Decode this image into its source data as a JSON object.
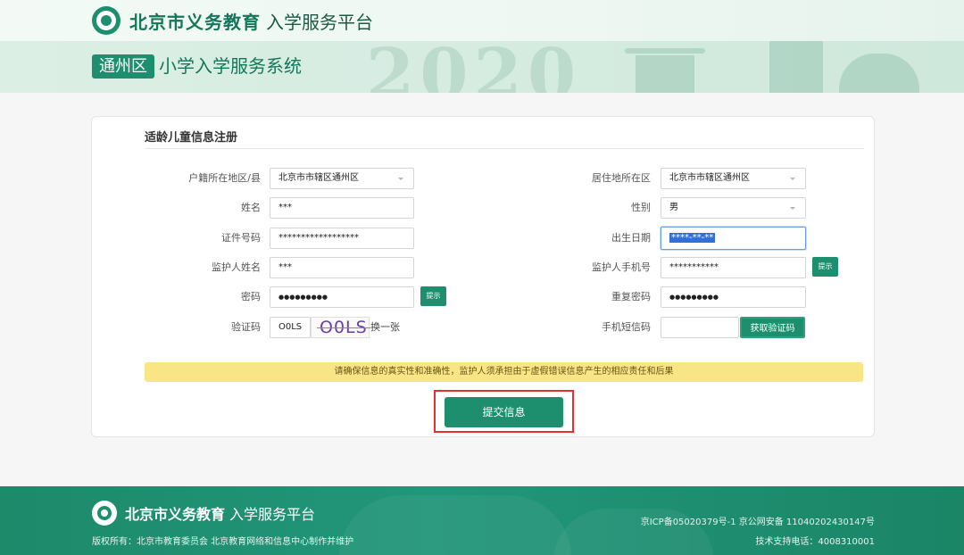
{
  "header": {
    "logo_bold": "北京市义务教育",
    "logo_light": "入学服务平台",
    "banner_year": "2020",
    "district": "通州区",
    "system_title": "小学入学服务系统"
  },
  "form": {
    "title": "适龄儿童信息注册",
    "hukou_district": {
      "label": "户籍所在地区/县",
      "value": "北京市市辖区通州区"
    },
    "residence_district": {
      "label": "居住地所在区",
      "value": "北京市市辖区通州区"
    },
    "name": {
      "label": "姓名",
      "value": "***"
    },
    "gender": {
      "label": "性别",
      "value": "男"
    },
    "id_number": {
      "label": "证件号码",
      "value": "******************"
    },
    "birth_date": {
      "label": "出生日期",
      "value": "****-**-**"
    },
    "guardian_name": {
      "label": "监护人姓名",
      "value": "***"
    },
    "guardian_phone": {
      "label": "监护人手机号",
      "value": "***********",
      "hint_button": "提示"
    },
    "password": {
      "label": "密码",
      "value": "●●●●●●●●●",
      "hint_button": "提示"
    },
    "password_confirm": {
      "label": "重复密码",
      "value": "●●●●●●●●●"
    },
    "captcha": {
      "label": "验证码",
      "value": "O0LS",
      "image_text": "O0LS",
      "refresh": "换一张"
    },
    "sms_code": {
      "label": "手机短信码",
      "value": "",
      "button": "获取验证码"
    },
    "notice": "请确保信息的真实性和准确性，监护人须承担由于虚假错误信息产生的相应责任和后果",
    "submit": "提交信息"
  },
  "footer": {
    "logo_bold": "北京市义务教育",
    "logo_light": "入学服务平台",
    "copyright": "版权所有：北京市教育委员会 北京教育网络和信息中心制作并维护",
    "icp": "京ICP备05020379号-1 京公网安备 11040202430147号",
    "support": "技术支持电话：4008310001"
  },
  "colors": {
    "brand_green": "#1e8f6e",
    "notice_yellow": "#f8e686",
    "highlight_red": "#e03030"
  }
}
